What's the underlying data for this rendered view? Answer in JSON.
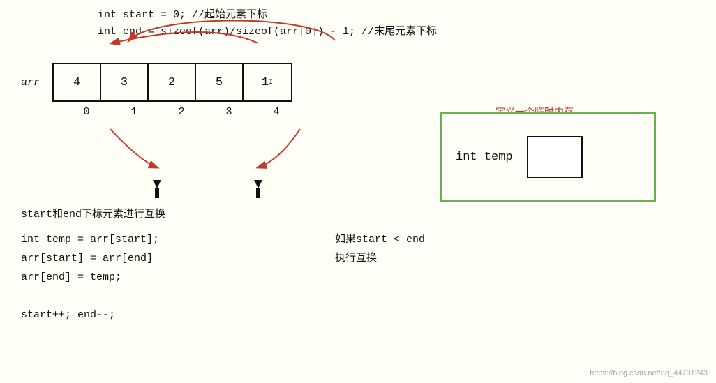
{
  "code": {
    "line1": "int start  = 0;  //起始元素下标",
    "line2": "int end = sizeof(arr)/sizeof(arr[0]) - 1;  //末尾元素下标"
  },
  "array": {
    "label": "arr",
    "cells": [
      "4",
      "3",
      "2",
      "5",
      "1"
    ],
    "indices": [
      "0",
      "1",
      "2",
      "3",
      "4"
    ]
  },
  "annotations": {
    "swap_text": "start和end下标元素进行互换",
    "define_temp": "定义一个临时内存",
    "temp_label": "int   temp",
    "condition": "如果start < end",
    "execute": "执行互换"
  },
  "code_block": {
    "line1": " int temp = arr[start];",
    "line2": " arr[start] = arr[end]",
    "line3": " arr[end] = temp;",
    "line4": "",
    "line5": " start++;     end--;"
  },
  "watermark": "https://blog.csdn.net/qq_44701243"
}
